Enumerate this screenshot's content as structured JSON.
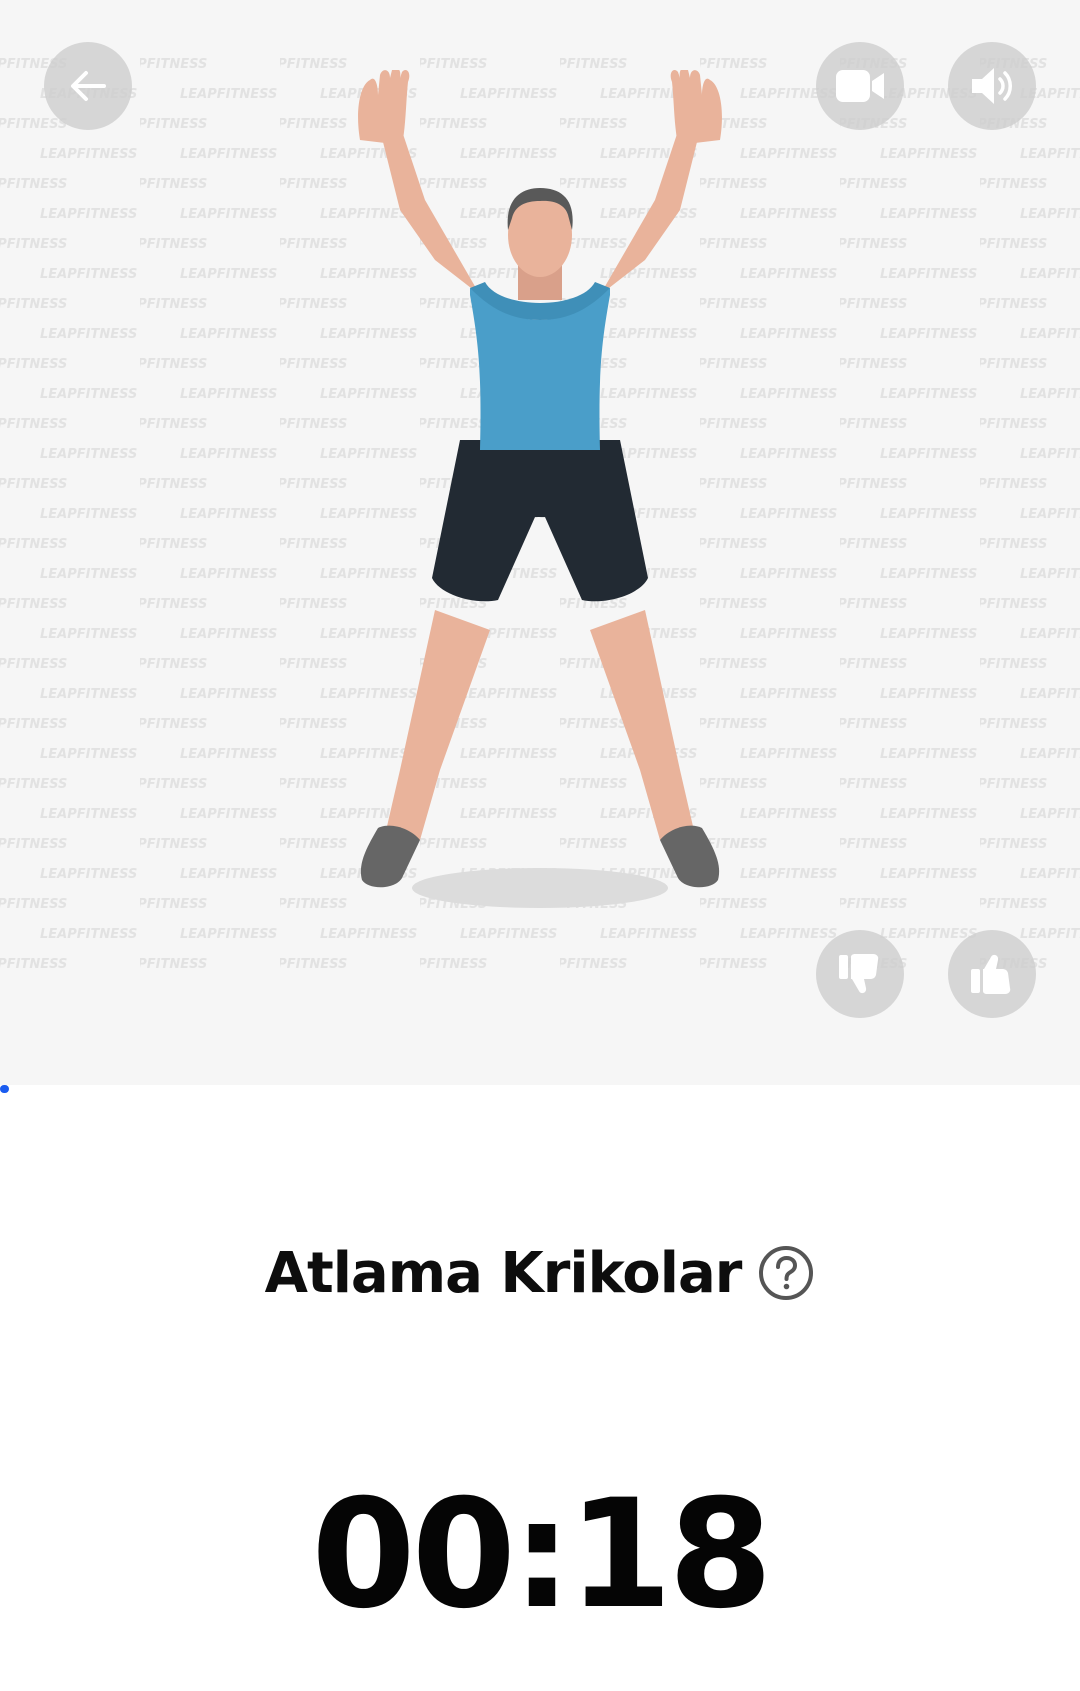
{
  "exercise": {
    "title": "Atlama Krikolar",
    "timer": "00:18",
    "progress_fraction": 0.008
  },
  "watermark": {
    "text": "LEAPFITNESS"
  },
  "icons": {
    "back": "arrow-left-icon",
    "video": "video-camera-icon",
    "sound": "speaker-volume-icon",
    "dislike": "thumbs-down-icon",
    "like": "thumbs-up-icon",
    "help": "question-circle-icon"
  },
  "colors": {
    "accent": "#1a5cf0",
    "hero_background": "#f6f6f6",
    "shirt": "#4a9ec9",
    "shorts": "#222a33",
    "skin": "#e9b39b",
    "shoes": "#666666"
  }
}
